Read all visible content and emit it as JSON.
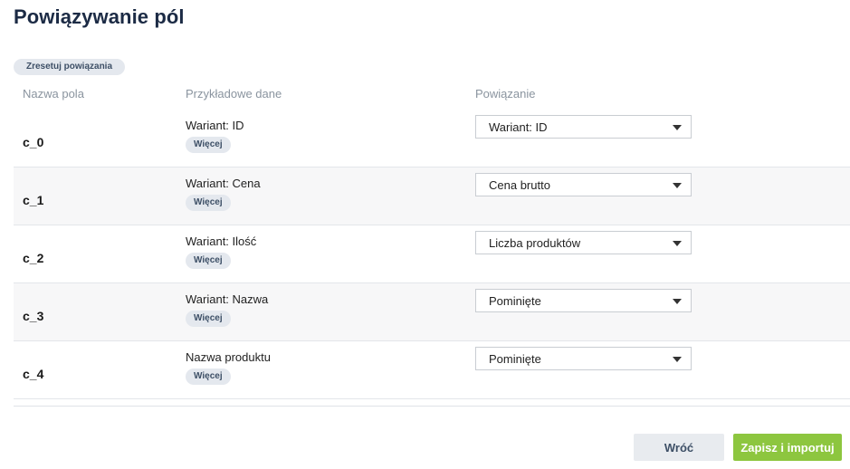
{
  "page": {
    "title": "Powiązywanie pól",
    "reset_label": "Zresetuj powiązania"
  },
  "table": {
    "headers": {
      "name": "Nazwa pola",
      "sample": "Przykładowe dane",
      "binding": "Powiązanie"
    },
    "more_label": "Więcej",
    "rows": [
      {
        "name": "c_0",
        "sample": "Wariant: ID",
        "binding": "Wariant: ID"
      },
      {
        "name": "c_1",
        "sample": "Wariant: Cena",
        "binding": "Cena brutto"
      },
      {
        "name": "c_2",
        "sample": "Wariant: Ilość",
        "binding": "Liczba produktów"
      },
      {
        "name": "c_3",
        "sample": "Wariant: Nazwa",
        "binding": "Pominięte"
      },
      {
        "name": "c_4",
        "sample": "Nazwa produktu",
        "binding": "Pominięte"
      }
    ]
  },
  "footer": {
    "back_label": "Wróć",
    "save_label": "Zapisz i importuj"
  },
  "colors": {
    "title": "#1c2b45",
    "accent_save": "#8dc63f",
    "pill_bg": "#e4e8ee",
    "row_alt_bg": "#f7f7f8"
  }
}
